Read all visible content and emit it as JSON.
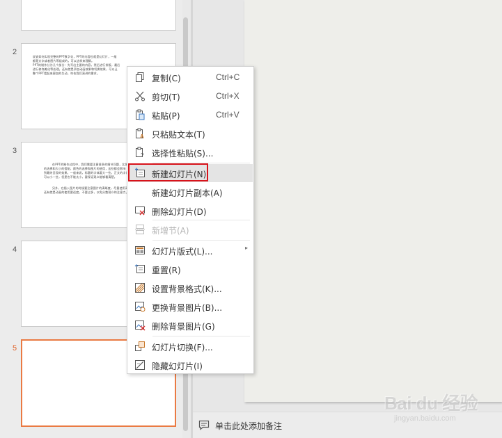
{
  "slides": [
    {
      "number": "2",
      "lines": [
        "说说如何实现完整的PPT数字化，PPT的内容也就是幻灯片，一般",
        "都是文字或者图片等组成的，可以这样来理解。",
        "PPT的制作分为几个部分：先写出主要的内容，然后进行排版，最后",
        "进行修饰美化等处理。还有就是添加动画效果和切换效果，可以让",
        "整个PPT看起来更加的生动，符合我们演讲的需求。"
      ]
    },
    {
      "number": "3",
      "lines": [
        "在PPT的制作过程中，我们需要注意很多的细节问题，比如说字体",
        "的选择和大小的搭配，颜色的选择和图片的使用，这些都会影响",
        "到最终呈现的效果。一般来说，标题的字体要大一些，正文的字体",
        "可以小一些，但是也不能太小，要保证观众能够看清楚。",
        "另外，在插入图片的时候要注意图片的清晰度，尽量使用高清图片，",
        "还有就是动画的使用要适度，不要过多，以免分散观众的注意力。"
      ]
    },
    {
      "number": "4",
      "lines": []
    },
    {
      "number": "5",
      "lines": []
    }
  ],
  "context_menu": {
    "items": [
      {
        "label": "复制(C)",
        "shortcut": "Ctrl+C",
        "icon": "copy-icon",
        "enabled": true
      },
      {
        "label": "剪切(T)",
        "shortcut": "Ctrl+X",
        "icon": "cut-icon",
        "enabled": true
      },
      {
        "label": "粘贴(P)",
        "shortcut": "Ctrl+V",
        "icon": "paste-icon",
        "enabled": true
      },
      {
        "label": "只粘贴文本(T)",
        "shortcut": "",
        "icon": "paste-text-icon",
        "enabled": true
      },
      {
        "label": "选择性粘贴(S)...",
        "shortcut": "",
        "icon": "paste-special-icon",
        "enabled": true
      },
      {
        "label": "新建幻灯片(N)",
        "shortcut": "",
        "icon": "new-slide-icon",
        "enabled": true,
        "highlighted": true
      },
      {
        "label": "新建幻灯片副本(A)",
        "shortcut": "",
        "icon": "",
        "enabled": true
      },
      {
        "label": "删除幻灯片(D)",
        "shortcut": "",
        "icon": "delete-slide-icon",
        "enabled": true
      },
      {
        "label": "新增节(A)",
        "shortcut": "",
        "icon": "new-section-icon",
        "enabled": false
      },
      {
        "label": "幻灯片版式(L)...",
        "shortcut": "",
        "icon": "layout-icon",
        "enabled": true,
        "submenu": true
      },
      {
        "label": "重置(R)",
        "shortcut": "",
        "icon": "reset-icon",
        "enabled": true
      },
      {
        "label": "设置背景格式(K)...",
        "shortcut": "",
        "icon": "background-format-icon",
        "enabled": true
      },
      {
        "label": "更换背景图片(B)...",
        "shortcut": "",
        "icon": "change-background-icon",
        "enabled": true
      },
      {
        "label": "删除背景图片(G)",
        "shortcut": "",
        "icon": "delete-background-icon",
        "enabled": true
      },
      {
        "label": "幻灯片切换(F)...",
        "shortcut": "",
        "icon": "slide-transition-icon",
        "enabled": true
      },
      {
        "label": "隐藏幻灯片(I)",
        "shortcut": "",
        "icon": "hide-slide-icon",
        "enabled": true
      }
    ],
    "submenu_arrow": "▸"
  },
  "notes": {
    "placeholder": "单击此处添加备注"
  },
  "watermark": {
    "logo": "Bai du 经验",
    "url": "jingyan.baidu.com"
  },
  "colors": {
    "highlight": "#d8121a",
    "selected_slide_border": "#ea7a43",
    "active_number": "#e0642a"
  }
}
